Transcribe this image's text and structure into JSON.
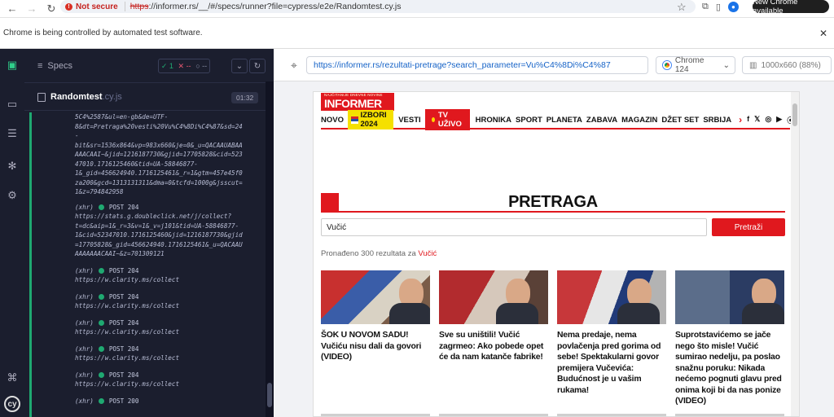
{
  "browser": {
    "not_secure_label": "Not secure",
    "url_scheme": "https",
    "url_rest": "://informer.rs/__/#/specs/runner?file=cypress/e2e/Randomtest.cy.js",
    "new_chrome_label": "New Chrome available",
    "infobar_text": "Chrome is being controlled by automated test software."
  },
  "cypress": {
    "specs_label": "Specs",
    "stats": {
      "passed": "1",
      "failed": "--",
      "pending": "--"
    },
    "spec_file_name": "Randomtest",
    "spec_file_ext": ".cy.js",
    "timer": "01:32",
    "log": {
      "first_block": "5C4%2587&ul=en-gb&de=UTF-\n8&dt=Pretraga%20vesti%20Vu%C4%8Di%C4%87&sd=24\n-\nbit&sr=1536x864&vp=983x660&je=0&_u=QACAAUABAA\nAAACAAI~&jid=1216187730&gjid=17705828&cid=523\n47010.1716125460&tid=UA-58846877-\n1&_gid=456624940.1716125461&_r=1&gtm=457e45f0\nza200&gcd=1313131311&dma=0&tcfd=1000g&jsscut=\n1&z=794842958",
      "requests": [
        {
          "type": "(xhr)",
          "method": "POST 204",
          "url": "https://stats.g.doubleclick.net/j/collect?\nt=dc&aip=1&_r=3&v=1&_v=j101&tid=UA-58846877-\n1&cid=52347010.1716125460&jid=1216187730&gjid\n=17705828&_gid=456624940.1716125461&_u=QACAAU\nAAAAAAACAAI~&z=701309121"
        },
        {
          "type": "(xhr)",
          "method": "POST 204",
          "url": "https://w.clarity.ms/collect"
        },
        {
          "type": "(xhr)",
          "method": "POST 204",
          "url": "https://w.clarity.ms/collect"
        },
        {
          "type": "(xhr)",
          "method": "POST 204",
          "url": "https://w.clarity.ms/collect"
        },
        {
          "type": "(xhr)",
          "method": "POST 204",
          "url": "https://w.clarity.ms/collect"
        },
        {
          "type": "(xhr)",
          "method": "POST 204",
          "url": "https://w.clarity.ms/collect"
        },
        {
          "type": "(xhr)",
          "method": "POST 200",
          "url": ""
        }
      ]
    },
    "aut_url": "https://informer.rs/rezultati-pretrage?search_parameter=Vu%C4%8Di%C4%87",
    "browser_name": "Chrome 124",
    "viewport": "1000x660 (88%)"
  },
  "site": {
    "logo_tagline": "NAJČITANIJE DNEVNE NOVINE",
    "logo_name": "INFORMER",
    "menu": {
      "novo": "NOVO",
      "izbori": "IZBORI 2024",
      "vesti": "VESTI",
      "tv_uzivo": "TV UŽIVO",
      "items": [
        "HRONIKA",
        "SPORT",
        "PLANETA",
        "ZABAVA",
        "MAGAZIN",
        "DŽET SET",
        "SRBIJA"
      ]
    },
    "page_heading": "PRETRAGA",
    "search_value": "Vučić",
    "search_button": "Pretraži",
    "results_prefix": "Pronađeno 300 rezultata za ",
    "results_query": "Vučić",
    "articles": [
      {
        "title": "ŠOK U NOVOM SADU! Vučiću nisu dali da govori (VIDEO)"
      },
      {
        "title": "Sve su uništili! Vučić zagrmeo: Ako pobede opet će da nam katanče fabrike!"
      },
      {
        "title": "Nema predaje, nema povlačenja pred gorima od sebe! Spektakularni govor premijera Vučevića: Budućnost je u vašim rukama!"
      },
      {
        "title": "Suprotstavićemo se jače nego što misle! Vučić sumirao nedelju, pa poslao snažnu poruku: Nikada nećemo pognuti glavu pred onima koji bi da nas ponize (VIDEO)"
      }
    ]
  },
  "colors": {
    "cypress_bg": "#1b1e2e",
    "pass": "#1fa971",
    "fail": "#e45770",
    "informer_red": "#e0181e",
    "izbori_yellow": "#f5e000"
  }
}
